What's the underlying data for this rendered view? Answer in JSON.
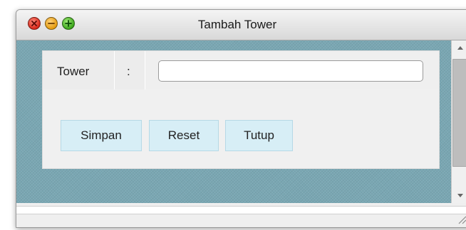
{
  "window": {
    "title": "Tambah Tower"
  },
  "form": {
    "tower_label": "Tower",
    "separator": ":",
    "tower_value": "",
    "tower_placeholder": ""
  },
  "buttons": {
    "simpan": "Simpan",
    "reset": "Reset",
    "tutup": "Tutup"
  },
  "icons": {
    "close": "close-icon",
    "minimize": "minimize-icon",
    "maximize": "maximize-icon",
    "scroll_up": "arrow-up-icon",
    "scroll_down": "arrow-down-icon",
    "resize": "resize-grip-icon"
  },
  "colors": {
    "background_pattern": "#7aa7b3",
    "button_fill": "#d7eef6",
    "close": "#d8281a",
    "minimize": "#e59c10",
    "maximize": "#3aa61a"
  }
}
